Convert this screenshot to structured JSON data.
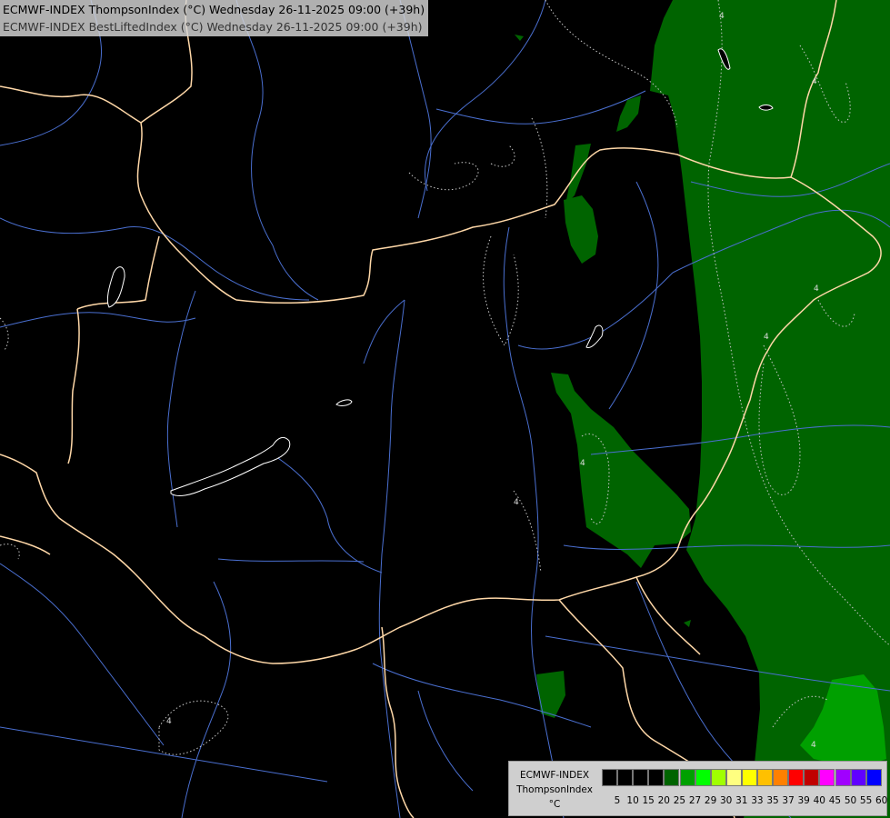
{
  "title": {
    "line1": "ECMWF-INDEX ThompsonIndex (°C) Wednesday 26-11-2025 09:00 (+39h)",
    "line2": "ECMWF-INDEX BestLiftedIndex (°C) Wednesday 26-11-2025 09:00 (+39h)"
  },
  "legend": {
    "label_line1": "ECMWF-INDEX",
    "label_line2": "ThompsonIndex",
    "label_line3": "°C",
    "ticks": [
      "5",
      "10",
      "15",
      "20",
      "25",
      "27",
      "29",
      "30",
      "31",
      "33",
      "35",
      "37",
      "39",
      "40",
      "45",
      "50",
      "55",
      "60"
    ],
    "colors": [
      "#000000",
      "#000000",
      "#000000",
      "#000000",
      "#006400",
      "#00a000",
      "#00ff00",
      "#a0ff00",
      "#ffff80",
      "#ffff00",
      "#ffc000",
      "#ff8000",
      "#ff0000",
      "#c00000",
      "#ff00ff",
      "#a000ff",
      "#6000ff",
      "#0000ff"
    ]
  },
  "colors": {
    "background": "#000000",
    "field_dark_green": "#006400",
    "field_green": "#00a000",
    "border": "#ffd8a8",
    "river": "#4a6fd0",
    "contour": "#c8c8c8",
    "lake_outline": "#ffffff"
  },
  "contour_labels": [
    "4",
    "4",
    "4",
    "4",
    "4",
    "4",
    "4",
    "4"
  ]
}
